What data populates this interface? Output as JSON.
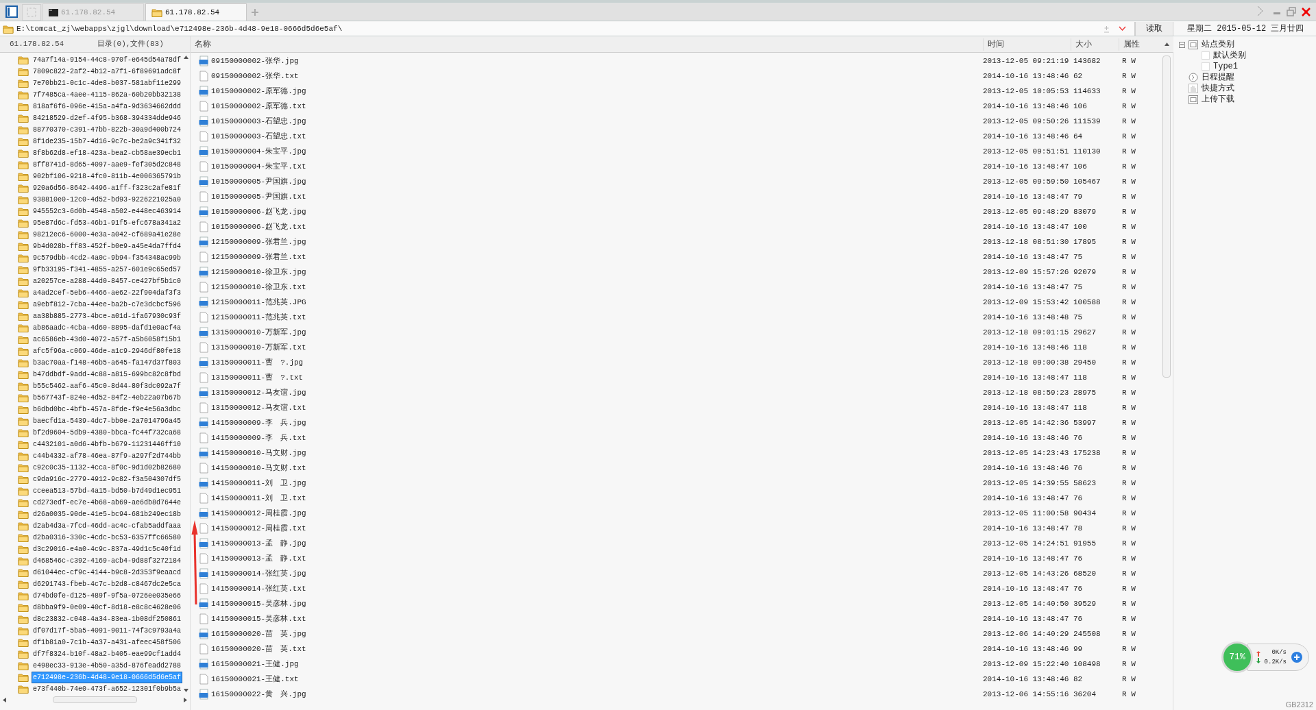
{
  "tabs": [
    {
      "label": "61.178.82.54",
      "kind": "terminal",
      "selected": false
    },
    {
      "label": "61.178.82.54",
      "kind": "folder",
      "selected": true
    }
  ],
  "path": "E:\\tomcat_zj\\webapps\\zjgl\\download\\e712498e-236b-4d48-9e18-0666d5d6e5af\\",
  "read_button": "读取",
  "date": "星期二 2015-05-12 三月廿四",
  "left_pane": {
    "host": "61.178.82.54",
    "summary": "目录(0),文件(83)",
    "folders": [
      {
        "name": "74a7f14a-9154-44c8-970f-e645d54a78df",
        "selected": false
      },
      {
        "name": "7809c822-2af2-4b12-a7f1-6f89691adc8f",
        "selected": false
      },
      {
        "name": "7e70bb21-0c1c-4de8-b037-581abf11e299",
        "selected": false
      },
      {
        "name": "7f7485ca-4aee-4115-862a-60b20bb32138",
        "selected": false
      },
      {
        "name": "818af6f6-096e-415a-a4fa-9d3634662ddd",
        "selected": false
      },
      {
        "name": "84218529-d2ef-4f95-b368-394334dde946",
        "selected": false
      },
      {
        "name": "88770370-c391-47bb-822b-30a9d400b724",
        "selected": false
      },
      {
        "name": "8f1de235-15b7-4d16-9c7c-be2a9c341f32",
        "selected": false
      },
      {
        "name": "8f8b62d8-ef18-423a-bea2-cb58ae39ecb1",
        "selected": false
      },
      {
        "name": "8ff8741d-8d65-4097-aae9-fef305d2c848",
        "selected": false
      },
      {
        "name": "902bf106-9218-4fc0-811b-4e006365791b",
        "selected": false
      },
      {
        "name": "920a6d56-8642-4496-a1ff-f323c2afe81f",
        "selected": false
      },
      {
        "name": "938810e0-12c0-4d52-bd93-9226221025a0",
        "selected": false
      },
      {
        "name": "945552c3-6d0b-4548-a502-e448ec463914",
        "selected": false
      },
      {
        "name": "95e87d6c-fd53-46b1-91f5-efc678a341a2",
        "selected": false
      },
      {
        "name": "98212ec6-6000-4e3a-a042-cf689a41e28e",
        "selected": false
      },
      {
        "name": "9b4d028b-ff83-452f-b0e9-a45e4da7ffd4",
        "selected": false
      },
      {
        "name": "9c579dbb-4cd2-4a0c-9b94-f354348ac99b",
        "selected": false
      },
      {
        "name": "9fb33195-f341-4855-a257-601e9c65ed57",
        "selected": false
      },
      {
        "name": "a20257ce-a288-44d0-8457-ce427bf5b1c0",
        "selected": false
      },
      {
        "name": "a4ad2cef-5eb6-4466-ae62-22f904daf3f3",
        "selected": false
      },
      {
        "name": "a9ebf812-7cba-44ee-ba2b-c7e3dcbcf596",
        "selected": false
      },
      {
        "name": "aa38b885-2773-4bce-a01d-1fa67930c93f",
        "selected": false
      },
      {
        "name": "ab86aadc-4cba-4d60-8895-dafd1e0acf4a",
        "selected": false
      },
      {
        "name": "ac6586eb-43d0-4072-a57f-a5b6058f15b1",
        "selected": false
      },
      {
        "name": "afc5f96a-c069-46de-a1c9-2946df80fe18",
        "selected": false
      },
      {
        "name": "b3ac70aa-f148-46b5-a645-fa147d37f803",
        "selected": false
      },
      {
        "name": "b47ddbdf-9add-4c88-a815-699bc82c8fbd",
        "selected": false
      },
      {
        "name": "b55c5462-aaf6-45c0-8d44-80f3dc092a7f",
        "selected": false
      },
      {
        "name": "b567743f-824e-4d52-84f2-4eb22a07b67b",
        "selected": false
      },
      {
        "name": "b6dbd0bc-4bfb-457a-8fde-f9e4e56a3dbc",
        "selected": false
      },
      {
        "name": "baecfd1a-5439-4dc7-bb0e-2a7014796a45",
        "selected": false
      },
      {
        "name": "bf2d9604-5db9-4380-bbca-fc44f732ca68",
        "selected": false
      },
      {
        "name": "c4432101-a0d6-4bfb-b679-11231446ff10",
        "selected": false
      },
      {
        "name": "c44b4332-af78-46ea-87f9-a297f2d744bb",
        "selected": false
      },
      {
        "name": "c92c0c35-1132-4cca-8f0c-9d1d02b82680",
        "selected": false
      },
      {
        "name": "c9da916c-2779-4912-9c82-f3a504307df5",
        "selected": false
      },
      {
        "name": "cceea513-57bd-4a15-bd50-b7d49d1ec951",
        "selected": false
      },
      {
        "name": "cd273edf-ec7e-4b68-ab69-ae6db8d7644e",
        "selected": false
      },
      {
        "name": "d26a0035-90de-41e5-bc94-681b249ec18b",
        "selected": false
      },
      {
        "name": "d2ab4d3a-7fcd-46dd-ac4c-cfab5addfaaa",
        "selected": false
      },
      {
        "name": "d2ba0316-330c-4cdc-bc53-6357ffc66580",
        "selected": false
      },
      {
        "name": "d3c29016-e4a0-4c9c-837a-49d1c5c40f1d",
        "selected": false
      },
      {
        "name": "d468546c-c392-4169-acb4-9d88f3272184",
        "selected": false
      },
      {
        "name": "d61044ec-cf9c-4144-b9c8-2d353f9eaacd",
        "selected": false
      },
      {
        "name": "d6291743-fbeb-4c7c-b2d8-c8467dc2e5ca",
        "selected": false
      },
      {
        "name": "d74bd0fe-d125-489f-9f5a-0726ee035e66",
        "selected": false
      },
      {
        "name": "d8bba9f9-0e09-40cf-8d18-e8c8c4628e06",
        "selected": false
      },
      {
        "name": "d8c23832-c048-4a34-83ea-1b08df250861",
        "selected": false
      },
      {
        "name": "df07d17f-5ba5-4091-9011-74f3c9793a4a",
        "selected": false
      },
      {
        "name": "df1b81a0-7c1b-4a37-a431-afeec458f506",
        "selected": false
      },
      {
        "name": "df7f8324-b10f-48a2-b405-eae99cf1add4",
        "selected": false
      },
      {
        "name": "e498ec33-913e-4b50-a35d-876feadd2788",
        "selected": false
      },
      {
        "name": "e712498e-236b-4d48-9e18-0666d5d6e5af",
        "selected": true
      },
      {
        "name": "e73f440b-74e0-473f-a652-12301f0b9b5a",
        "selected": false
      }
    ]
  },
  "file_list": {
    "columns": [
      "名称",
      "时间",
      "大小",
      "属性"
    ],
    "rows": [
      {
        "kind": "jpg",
        "name": "09150000002-张华.jpg",
        "time": "2013-12-05 09:21:19",
        "size": "143682",
        "attr": "R W"
      },
      {
        "kind": "txt",
        "name": "09150000002-张华.txt",
        "time": "2014-10-16 13:48:46",
        "size": "62",
        "attr": "R W"
      },
      {
        "kind": "jpg",
        "name": "10150000002-原军德.jpg",
        "time": "2013-12-05 10:05:53",
        "size": "114633",
        "attr": "R W"
      },
      {
        "kind": "txt",
        "name": "10150000002-原军德.txt",
        "time": "2014-10-16 13:48:46",
        "size": "106",
        "attr": "R W"
      },
      {
        "kind": "jpg",
        "name": "10150000003-石望忠.jpg",
        "time": "2013-12-05 09:50:26",
        "size": "111539",
        "attr": "R W"
      },
      {
        "kind": "txt",
        "name": "10150000003-石望忠.txt",
        "time": "2014-10-16 13:48:46",
        "size": "64",
        "attr": "R W"
      },
      {
        "kind": "jpg",
        "name": "10150000004-朱宝平.jpg",
        "time": "2013-12-05 09:51:51",
        "size": "110130",
        "attr": "R W"
      },
      {
        "kind": "txt",
        "name": "10150000004-朱宝平.txt",
        "time": "2014-10-16 13:48:47",
        "size": "106",
        "attr": "R W"
      },
      {
        "kind": "jpg",
        "name": "10150000005-尹国旗.jpg",
        "time": "2013-12-05 09:59:50",
        "size": "105467",
        "attr": "R W"
      },
      {
        "kind": "txt",
        "name": "10150000005-尹国旗.txt",
        "time": "2014-10-16 13:48:47",
        "size": "79",
        "attr": "R W"
      },
      {
        "kind": "jpg",
        "name": "10150000006-赵飞龙.jpg",
        "time": "2013-12-05 09:48:29",
        "size": "83079",
        "attr": "R W"
      },
      {
        "kind": "txt",
        "name": "10150000006-赵飞龙.txt",
        "time": "2014-10-16 13:48:47",
        "size": "100",
        "attr": "R W"
      },
      {
        "kind": "jpg",
        "name": "12150000009-张君兰.jpg",
        "time": "2013-12-18 08:51:30",
        "size": "17895",
        "attr": "R W"
      },
      {
        "kind": "txt",
        "name": "12150000009-张君兰.txt",
        "time": "2014-10-16 13:48:47",
        "size": "75",
        "attr": "R W"
      },
      {
        "kind": "jpg",
        "name": "12150000010-徐卫东.jpg",
        "time": "2013-12-09 15:57:26",
        "size": "92079",
        "attr": "R W"
      },
      {
        "kind": "txt",
        "name": "12150000010-徐卫东.txt",
        "time": "2014-10-16 13:48:47",
        "size": "75",
        "attr": "R W"
      },
      {
        "kind": "jpg",
        "name": "12150000011-范兆英.JPG",
        "time": "2013-12-09 15:53:42",
        "size": "100588",
        "attr": "R W"
      },
      {
        "kind": "txt",
        "name": "12150000011-范兆英.txt",
        "time": "2014-10-16 13:48:48",
        "size": "75",
        "attr": "R W"
      },
      {
        "kind": "jpg",
        "name": "13150000010-万新军.jpg",
        "time": "2013-12-18 09:01:15",
        "size": "29627",
        "attr": "R W"
      },
      {
        "kind": "txt",
        "name": "13150000010-万新军.txt",
        "time": "2014-10-16 13:48:46",
        "size": "118",
        "attr": "R W"
      },
      {
        "kind": "jpg",
        "name": "13150000011-曹　?.jpg",
        "time": "2013-12-18 09:00:38",
        "size": "29450",
        "attr": "R W"
      },
      {
        "kind": "txt",
        "name": "13150000011-曹　?.txt",
        "time": "2014-10-16 13:48:47",
        "size": "118",
        "attr": "R W"
      },
      {
        "kind": "jpg",
        "name": "13150000012-马友谊.jpg",
        "time": "2013-12-18 08:59:23",
        "size": "28975",
        "attr": "R W"
      },
      {
        "kind": "txt",
        "name": "13150000012-马友谊.txt",
        "time": "2014-10-16 13:48:47",
        "size": "118",
        "attr": "R W"
      },
      {
        "kind": "jpg",
        "name": "14150000009-李　兵.jpg",
        "time": "2013-12-05 14:42:36",
        "size": "53997",
        "attr": "R W"
      },
      {
        "kind": "txt",
        "name": "14150000009-李　兵.txt",
        "time": "2014-10-16 13:48:46",
        "size": "76",
        "attr": "R W"
      },
      {
        "kind": "jpg",
        "name": "14150000010-马文财.jpg",
        "time": "2013-12-05 14:23:43",
        "size": "175238",
        "attr": "R W"
      },
      {
        "kind": "txt",
        "name": "14150000010-马文财.txt",
        "time": "2014-10-16 13:48:46",
        "size": "76",
        "attr": "R W"
      },
      {
        "kind": "jpg",
        "name": "14150000011-刘　卫.jpg",
        "time": "2013-12-05 14:39:55",
        "size": "58623",
        "attr": "R W"
      },
      {
        "kind": "txt",
        "name": "14150000011-刘　卫.txt",
        "time": "2014-10-16 13:48:47",
        "size": "76",
        "attr": "R W"
      },
      {
        "kind": "jpg",
        "name": "14150000012-周桂霞.jpg",
        "time": "2013-12-05 11:00:58",
        "size": "90434",
        "attr": "R W"
      },
      {
        "kind": "txt",
        "name": "14150000012-周桂霞.txt",
        "time": "2014-10-16 13:48:47",
        "size": "78",
        "attr": "R W"
      },
      {
        "kind": "jpg",
        "name": "14150000013-孟　静.jpg",
        "time": "2013-12-05 14:24:51",
        "size": "91955",
        "attr": "R W"
      },
      {
        "kind": "txt",
        "name": "14150000013-孟　静.txt",
        "time": "2014-10-16 13:48:47",
        "size": "76",
        "attr": "R W"
      },
      {
        "kind": "jpg",
        "name": "14150000014-张红英.jpg",
        "time": "2013-12-05 14:43:26",
        "size": "68520",
        "attr": "R W"
      },
      {
        "kind": "txt",
        "name": "14150000014-张红英.txt",
        "time": "2014-10-16 13:48:47",
        "size": "76",
        "attr": "R W"
      },
      {
        "kind": "jpg",
        "name": "14150000015-吴彦林.jpg",
        "time": "2013-12-05 14:40:50",
        "size": "39529",
        "attr": "R W"
      },
      {
        "kind": "txt",
        "name": "14150000015-吴彦林.txt",
        "time": "2014-10-16 13:48:47",
        "size": "76",
        "attr": "R W"
      },
      {
        "kind": "jpg",
        "name": "16150000020-苗　英.jpg",
        "time": "2013-12-06 14:40:29",
        "size": "245508",
        "attr": "R W"
      },
      {
        "kind": "txt",
        "name": "16150000020-苗　英.txt",
        "time": "2014-10-16 13:48:46",
        "size": "99",
        "attr": "R W"
      },
      {
        "kind": "jpg",
        "name": "16150000021-王健.jpg",
        "time": "2013-12-09 15:22:40",
        "size": "108498",
        "attr": "R W"
      },
      {
        "kind": "txt",
        "name": "16150000021-王健.txt",
        "time": "2014-10-16 13:48:46",
        "size": "82",
        "attr": "R W"
      },
      {
        "kind": "jpg",
        "name": "16150000022-黄　兴.jpg",
        "time": "2013-12-06 14:55:16",
        "size": "36204",
        "attr": "R W"
      }
    ]
  },
  "side_tree": [
    {
      "label": "站点类别",
      "kind": "category",
      "expanded": true,
      "children": [
        {
          "label": "默认类别"
        },
        {
          "label": "Type1"
        }
      ]
    },
    {
      "label": "日程提醒",
      "kind": "clock"
    },
    {
      "label": "快捷方式",
      "kind": "hand"
    },
    {
      "label": "上传下载",
      "kind": "box"
    }
  ],
  "speed_widget": {
    "percent": "71%",
    "up": "0K/s",
    "down": "0.2K/s"
  },
  "encoding": "GB2312"
}
